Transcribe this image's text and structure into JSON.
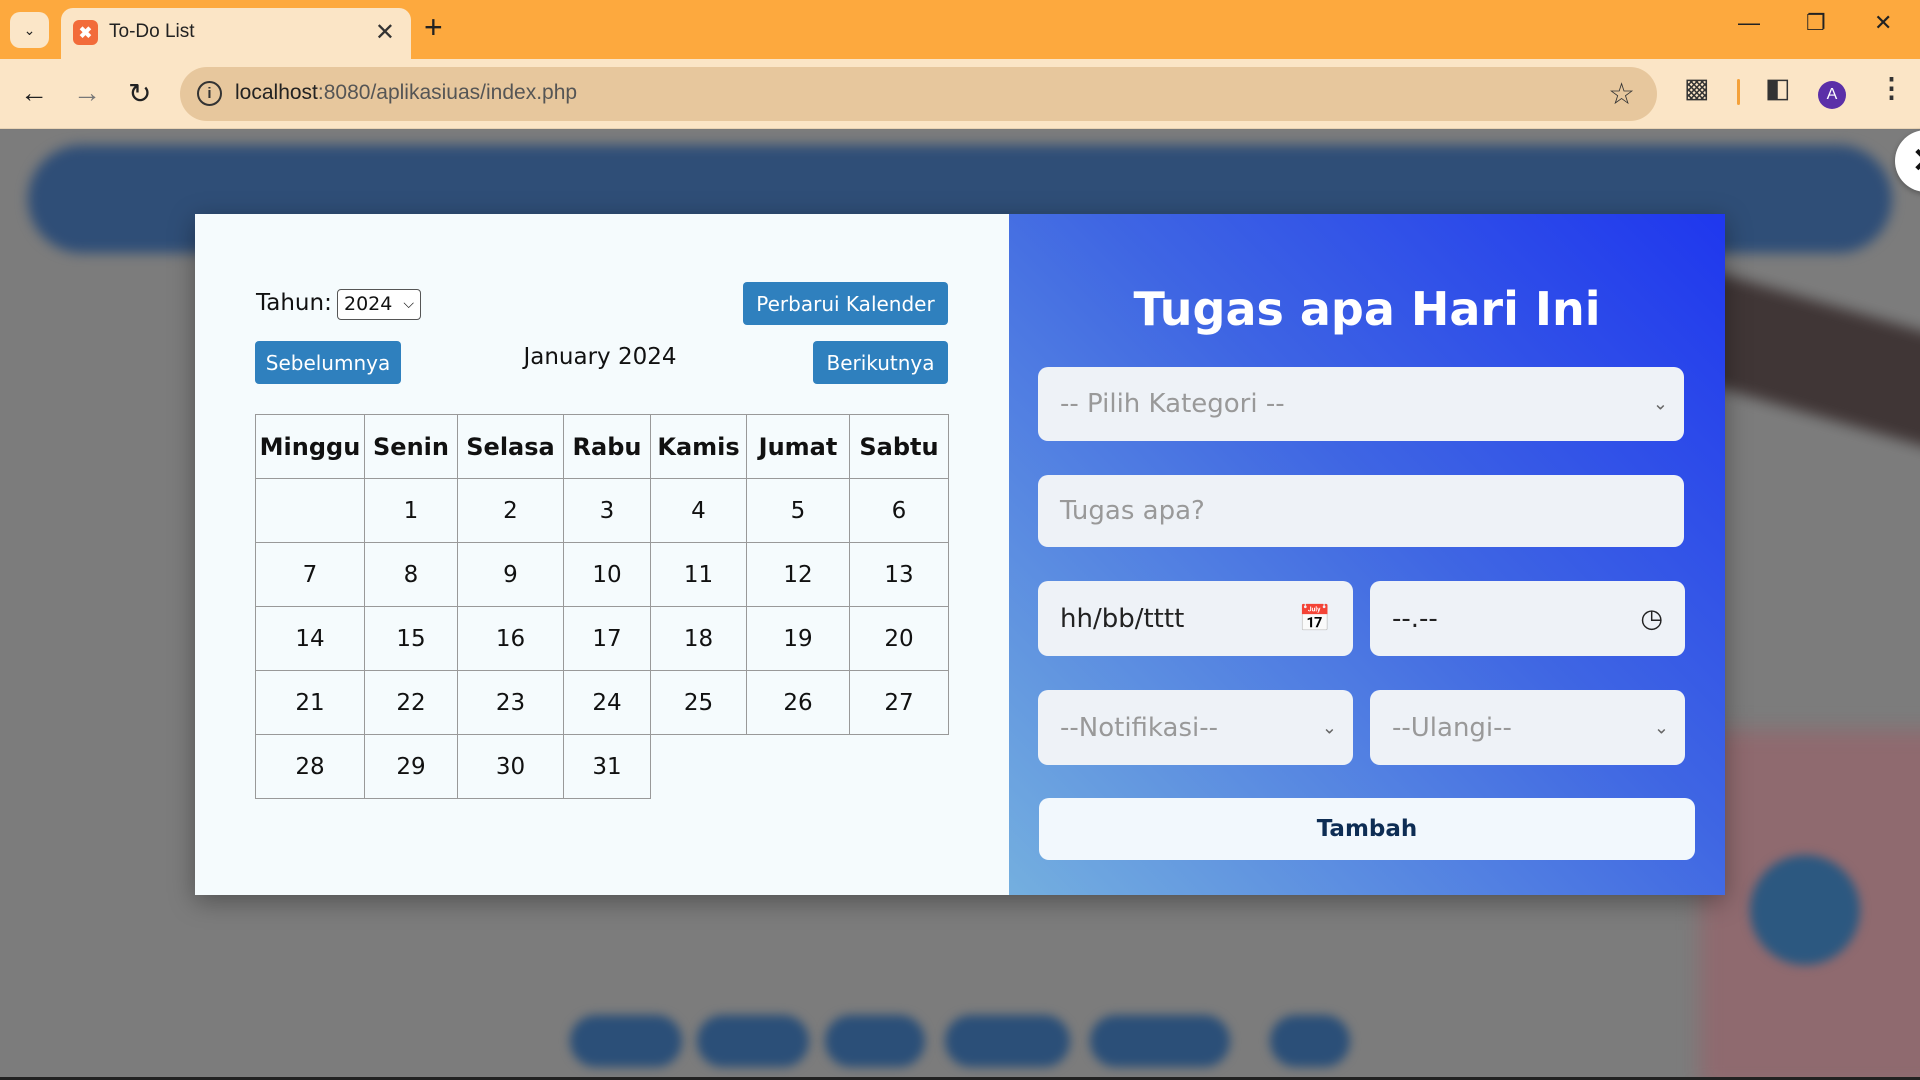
{
  "browser": {
    "tab_title": "To-Do List",
    "url_host": "localhost",
    "url_rest": ":8080/aplikasiuas/index.php",
    "profile_initial": "A"
  },
  "calendar": {
    "year_label": "Tahun:",
    "year_value": "2024",
    "refresh_button": "Perbarui Kalender",
    "prev_button": "Sebelumnya",
    "next_button": "Berikutnya",
    "month_title": "January 2024",
    "weekdays": [
      "Minggu",
      "Senin",
      "Selasa",
      "Rabu",
      "Kamis",
      "Jumat",
      "Sabtu"
    ],
    "weeks": [
      [
        "",
        "1",
        "2",
        "3",
        "4",
        "5",
        "6"
      ],
      [
        "7",
        "8",
        "9",
        "10",
        "11",
        "12",
        "13"
      ],
      [
        "14",
        "15",
        "16",
        "17",
        "18",
        "19",
        "20"
      ],
      [
        "21",
        "22",
        "23",
        "24",
        "25",
        "26",
        "27"
      ],
      [
        "28",
        "29",
        "30",
        "31",
        "",
        "",
        ""
      ]
    ]
  },
  "form": {
    "title": "Tugas apa Hari Ini",
    "category_placeholder": "-- Pilih Kategori --",
    "task_placeholder": "Tugas apa?",
    "date_placeholder": "hh/bb/tttt",
    "time_placeholder": "--.--",
    "notification_placeholder": "--Notifikasi--",
    "repeat_placeholder": "--Ulangi--",
    "submit_label": "Tambah"
  },
  "icons": {
    "close_modal": "close-icon",
    "calendar": "calendar-icon",
    "clock": "clock-icon"
  },
  "colors": {
    "tabbar": "#fda93e",
    "toolbar": "#fbe5c6",
    "button_blue": "#2f80be",
    "form_gradient_start": "#1f37ee",
    "form_gradient_end": "#74afdf",
    "submit_text": "#0e2d54"
  }
}
